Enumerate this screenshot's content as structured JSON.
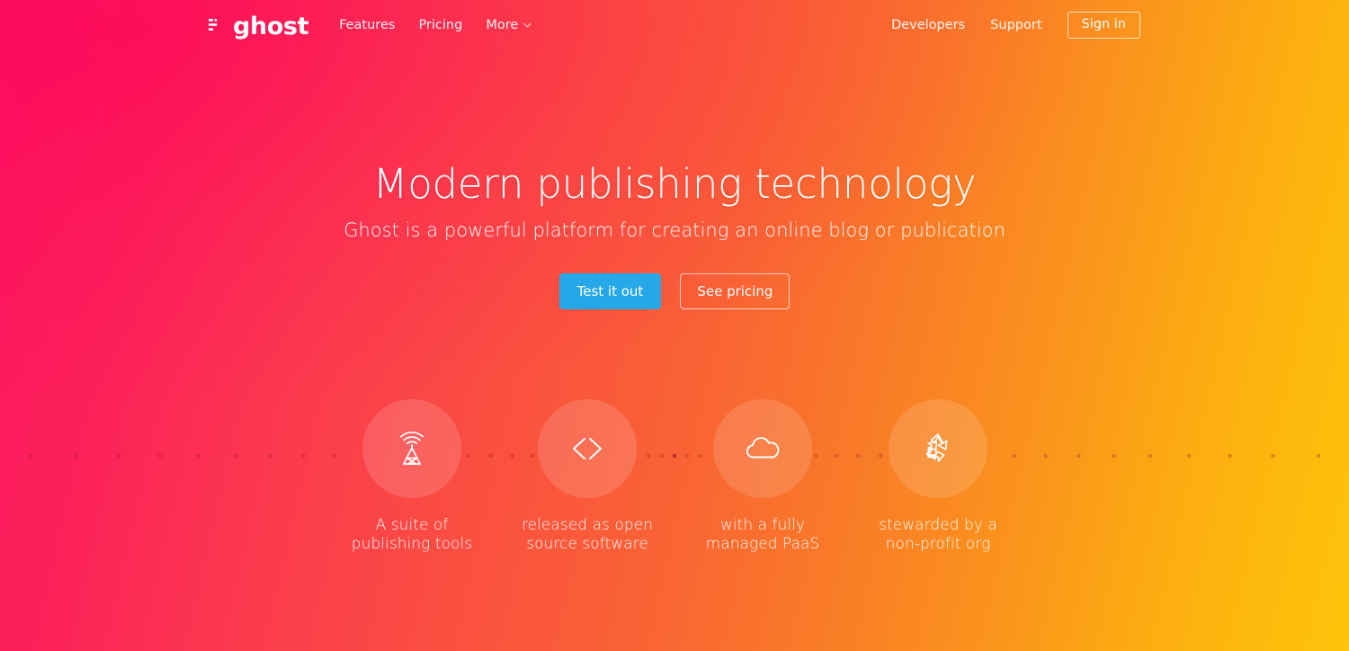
{
  "site": {
    "brand": "ghost",
    "brand_icon": "ghost-lines-logo-icon"
  },
  "header": {
    "nav_left": [
      {
        "label": "Features",
        "icon": null
      },
      {
        "label": "Pricing",
        "icon": null
      },
      {
        "label": "More",
        "icon": "chevron-down-icon"
      }
    ],
    "nav_right": [
      {
        "label": "Developers"
      },
      {
        "label": "Support"
      }
    ],
    "signin_label": "Sign in"
  },
  "hero": {
    "title": "Modern publishing technology",
    "subtitle": "Ghost is a powerful platform for creating an online blog or publication",
    "primary_cta": "Test it out",
    "secondary_cta": "See pricing"
  },
  "features": [
    {
      "icon": "broadcast-tower-icon",
      "line1": "A suite of",
      "line2": "publishing tools"
    },
    {
      "icon": "code-brackets-icon",
      "line1": "released as open",
      "line2": "source software"
    },
    {
      "icon": "cloud-icon",
      "line1": "with a fully",
      "line2": "managed PaaS"
    },
    {
      "icon": "recycle-icon",
      "line1": "stewarded by a",
      "line2": "non-profit org"
    }
  ],
  "colors": {
    "gradient_start": "#FC1561",
    "gradient_mid": "#F96235",
    "gradient_end": "#FDC40A",
    "primary_button": "#26A8E8",
    "text_on_brand": "#FFFFFF"
  }
}
